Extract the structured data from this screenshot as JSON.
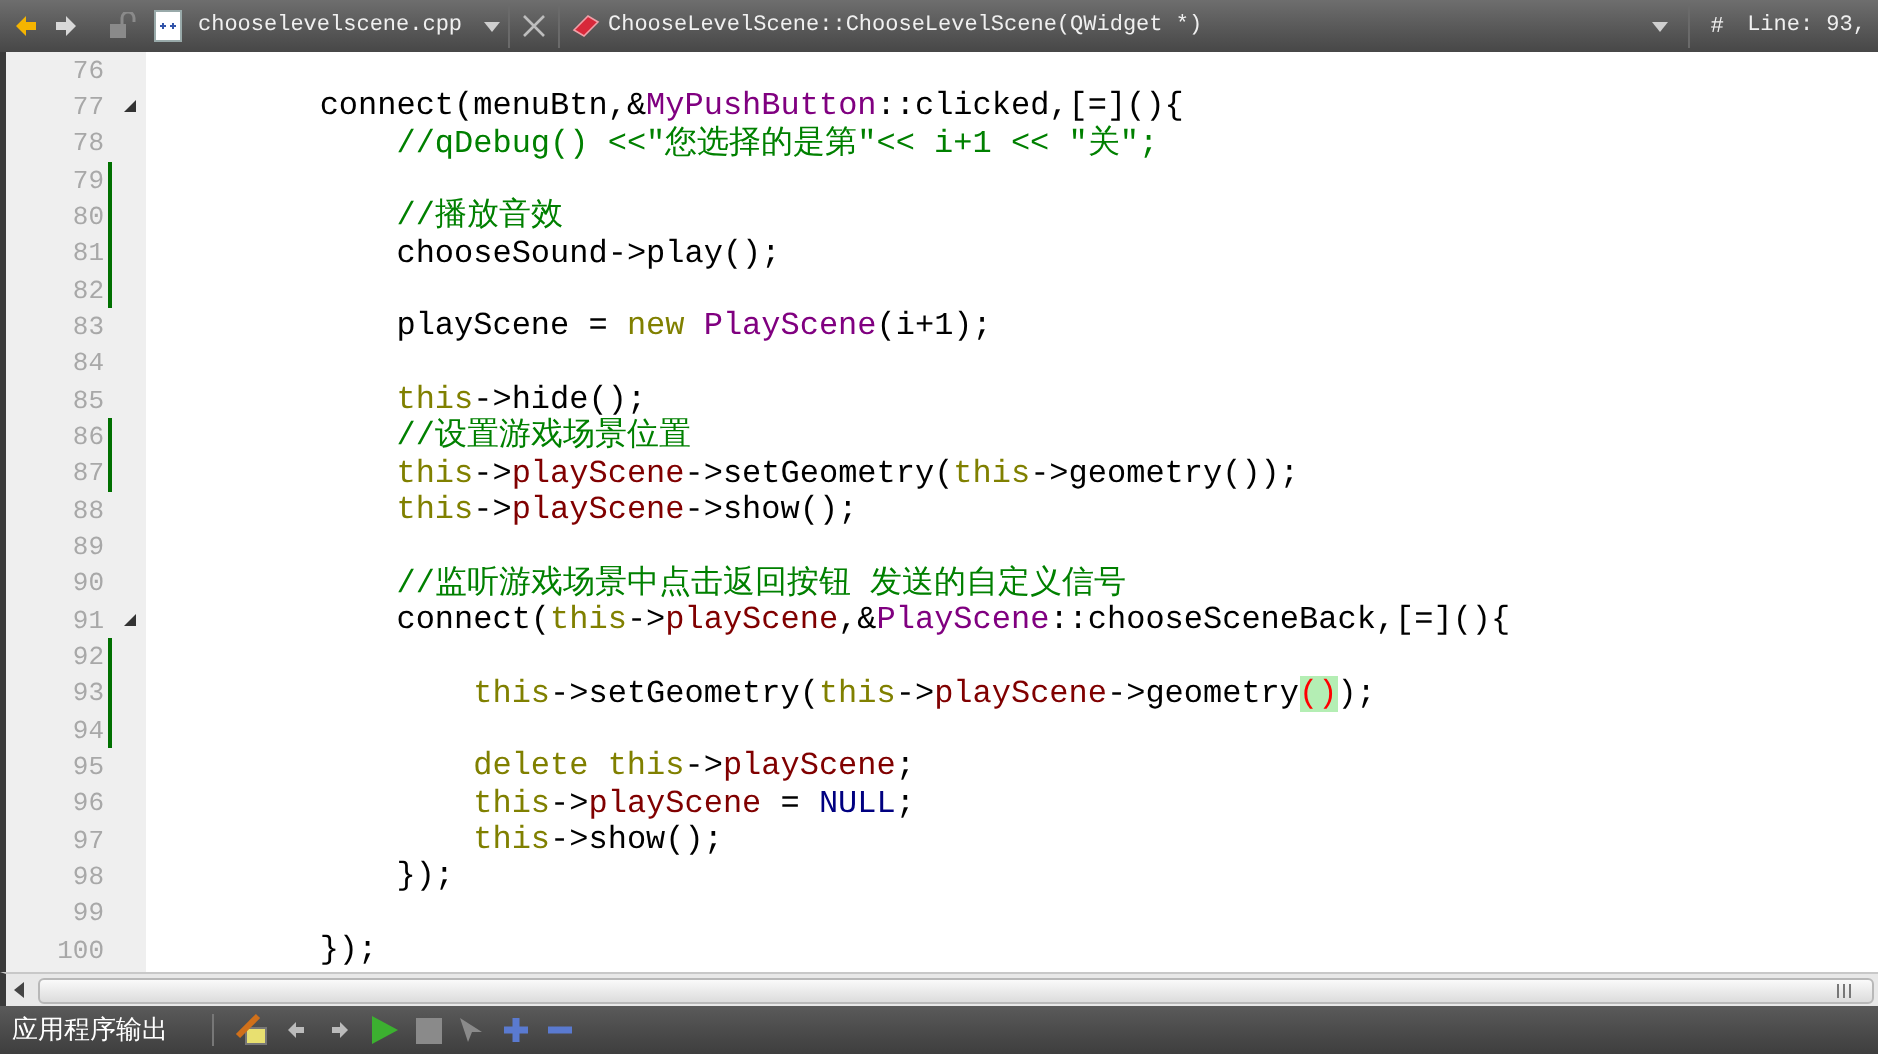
{
  "toolbar": {
    "file_name": "chooselevelscene.cpp",
    "symbol": "ChooseLevelScene::ChooseLevelScene(QWidget *)",
    "hash": "#",
    "position": "Line: 93,"
  },
  "lines": [
    {
      "number": "76",
      "modified": false,
      "fold": false
    },
    {
      "number": "77",
      "modified": false,
      "fold": true,
      "tokens": [
        {
          "kind": "plain",
          "text": "connect(menuBtn,&"
        },
        {
          "kind": "type",
          "text": "MyPushButton"
        },
        {
          "kind": "plain",
          "text": "::clicked,[=](){"
        }
      ],
      "children": [
        {
          "number": "78",
          "modified": false,
          "fold": false,
          "tokens": [
            {
              "kind": "comment",
              "text": "//qDebug() <<\"您选择的是第\"<< i+1 << \"关\";"
            }
          ]
        },
        {
          "number": "79",
          "modified": true,
          "fold": false
        },
        {
          "number": "80",
          "modified": true,
          "fold": false,
          "tokens": [
            {
              "kind": "comment",
              "text": "//播放音效"
            }
          ]
        },
        {
          "number": "81",
          "modified": true,
          "fold": false,
          "tokens": [
            {
              "kind": "plain",
              "text": "chooseSound->play();"
            }
          ]
        },
        {
          "number": "82",
          "modified": true,
          "fold": false
        },
        {
          "number": "83",
          "modified": false,
          "fold": false,
          "tokens": [
            {
              "kind": "plain",
              "text": "playScene ="
            },
            {
              "kind": "keyword",
              "text": "new",
              "gap_before": true
            },
            {
              "kind": "type",
              "text": "PlayScene",
              "gap_before": true
            },
            {
              "kind": "plain",
              "text": "(i+1);"
            }
          ]
        },
        {
          "number": "84",
          "modified": false,
          "fold": false
        },
        {
          "number": "85",
          "modified": false,
          "fold": false,
          "tokens": [
            {
              "kind": "keyword",
              "text": "this"
            },
            {
              "kind": "plain",
              "text": "->hide();"
            }
          ]
        },
        {
          "number": "86",
          "modified": true,
          "fold": false,
          "tokens": [
            {
              "kind": "comment",
              "text": "//设置游戏场景位置"
            }
          ]
        },
        {
          "number": "87",
          "modified": true,
          "fold": false,
          "tokens": [
            {
              "kind": "keyword",
              "text": "this"
            },
            {
              "kind": "plain",
              "text": "->"
            },
            {
              "kind": "field",
              "text": "playScene"
            },
            {
              "kind": "plain",
              "text": "->setGeometry("
            },
            {
              "kind": "keyword",
              "text": "this"
            },
            {
              "kind": "plain",
              "text": "->geometry());"
            }
          ]
        },
        {
          "number": "88",
          "modified": false,
          "fold": false,
          "tokens": [
            {
              "kind": "keyword",
              "text": "this"
            },
            {
              "kind": "plain",
              "text": "->"
            },
            {
              "kind": "field",
              "text": "playScene"
            },
            {
              "kind": "plain",
              "text": "->show();"
            }
          ]
        },
        {
          "number": "89",
          "modified": false,
          "fold": false
        },
        {
          "number": "90",
          "modified": false,
          "fold": false,
          "tokens": [
            {
              "kind": "comment",
              "text": "//监听游戏场景中点击返回按钮 发送的自定义信号"
            }
          ]
        },
        {
          "number": "91",
          "modified": false,
          "fold": true,
          "tokens": [
            {
              "kind": "plain",
              "text": "connect("
            },
            {
              "kind": "keyword",
              "text": "this"
            },
            {
              "kind": "plain",
              "text": "->"
            },
            {
              "kind": "field",
              "text": "playScene"
            },
            {
              "kind": "plain",
              "text": ",&"
            },
            {
              "kind": "type",
              "text": "PlayScene"
            },
            {
              "kind": "plain",
              "text": "::chooseSceneBack,[=](){"
            }
          ],
          "children": [
            {
              "number": "92",
              "modified": true,
              "fold": false
            },
            {
              "number": "93",
              "modified": true,
              "fold": false,
              "tokens": [
                {
                  "kind": "keyword",
                  "text": "this"
                },
                {
                  "kind": "plain",
                  "text": "->setGeometry("
                },
                {
                  "kind": "keyword",
                  "text": "this"
                },
                {
                  "kind": "plain",
                  "text": "->"
                },
                {
                  "kind": "field",
                  "text": "playScene"
                },
                {
                  "kind": "plain",
                  "text": "->geometry"
                },
                {
                  "kind": "match",
                  "text": "()"
                },
                {
                  "kind": "plain",
                  "text": ");"
                }
              ]
            },
            {
              "number": "94",
              "modified": true,
              "fold": false
            },
            {
              "number": "95",
              "modified": false,
              "fold": false,
              "tokens": [
                {
                  "kind": "keyword",
                  "text": "delete"
                },
                {
                  "kind": "keyword",
                  "text": "this",
                  "gap_before": true
                },
                {
                  "kind": "plain",
                  "text": "->"
                },
                {
                  "kind": "field",
                  "text": "playScene"
                },
                {
                  "kind": "plain",
                  "text": ";"
                }
              ]
            },
            {
              "number": "96",
              "modified": false,
              "fold": false,
              "tokens": [
                {
                  "kind": "keyword",
                  "text": "this"
                },
                {
                  "kind": "plain",
                  "text": "->"
                },
                {
                  "kind": "field",
                  "text": "playScene"
                },
                {
                  "kind": "plain",
                  "text": "=",
                  "gap_before": true
                },
                {
                  "kind": "macro",
                  "text": "NULL",
                  "gap_before": true
                },
                {
                  "kind": "plain",
                  "text": ";"
                }
              ]
            },
            {
              "number": "97",
              "modified": false,
              "fold": false,
              "tokens": [
                {
                  "kind": "keyword",
                  "text": "this"
                },
                {
                  "kind": "plain",
                  "text": "->show();"
                }
              ]
            }
          ]
        },
        {
          "number": "98",
          "modified": false,
          "fold": false,
          "tokens": [
            {
              "kind": "plain",
              "text": "});"
            }
          ]
        }
      ]
    },
    {
      "number": "99",
      "modified": false,
      "fold": false
    },
    {
      "number": "100",
      "modified": false,
      "fold": false,
      "tokens": [
        {
          "kind": "plain",
          "text": "});"
        }
      ]
    }
  ],
  "output_pane": {
    "title": "应用程序输出"
  }
}
